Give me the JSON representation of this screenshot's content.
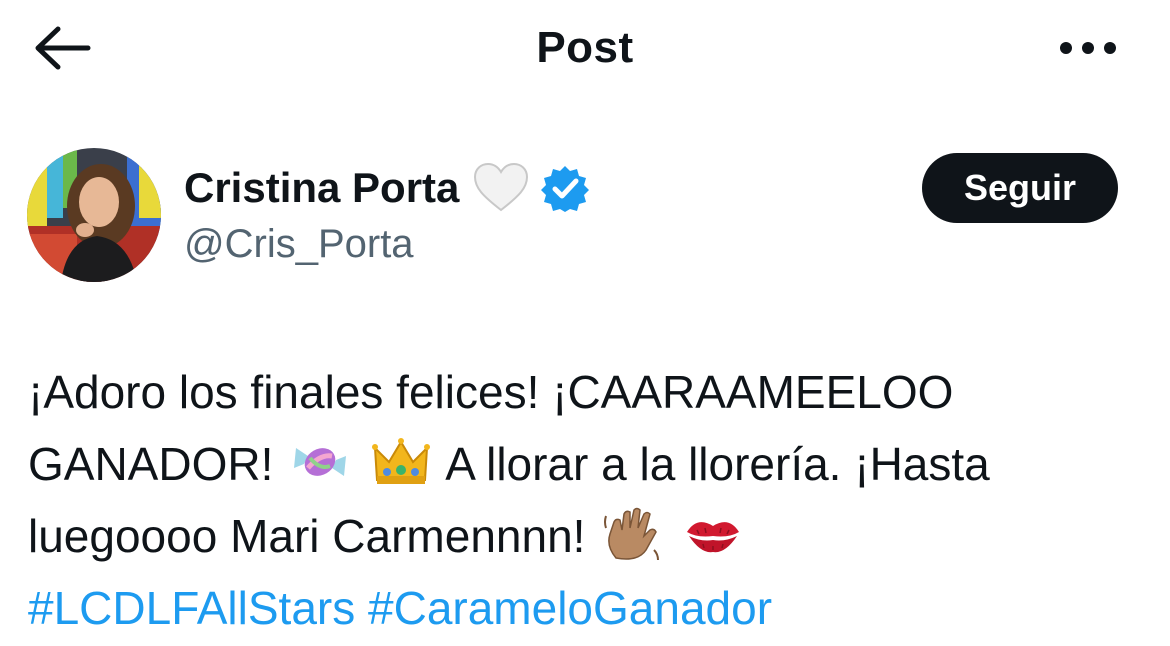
{
  "header": {
    "title": "Post",
    "back_icon": "arrow-left-icon",
    "more_icon": "more-horizontal-icon"
  },
  "author": {
    "display_name": "Cristina Porta",
    "handle": "@Cris_Porta",
    "name_emoji": "white-heart-icon",
    "verified_icon": "verified-badge-icon",
    "verified_color": "#1d9bf0"
  },
  "follow_button": {
    "label": "Seguir",
    "bg_color": "#0f1419"
  },
  "tweet": {
    "line1": "¡Adoro los finales felices! ¡CAARAAMEELOO",
    "line2_a": "GANADOR!",
    "line2_b": "A llorar a la llorería. ¡Hasta",
    "line3": "luegoooo Mari Carmennnn!",
    "hashtags": [
      "#LCDLFAllStars",
      "#CarameloGanador"
    ],
    "emojis": [
      "candy-icon",
      "crown-icon",
      "waving-hand-icon",
      "kiss-mark-icon"
    ],
    "hashtag_color": "#1d9bf0"
  }
}
